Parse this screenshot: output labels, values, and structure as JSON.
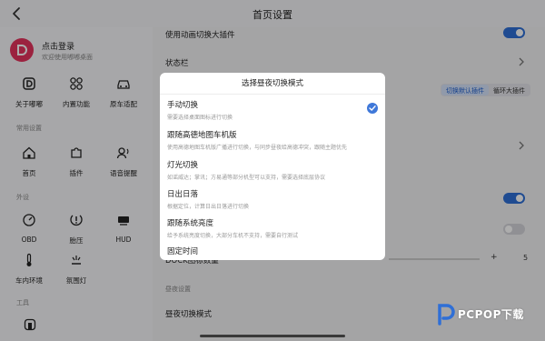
{
  "header": {
    "title": "首页设置",
    "back_icon": "chevron-left-icon"
  },
  "sidebar": {
    "user": {
      "title": "点击登录",
      "subtitle": "欢迎使用嘟嘟桌面",
      "avatar_color": "#e5335d"
    },
    "top_items": [
      {
        "label": "关于嘟嘟",
        "icon": "dudu-logo-icon"
      },
      {
        "label": "内置功能",
        "icon": "grid-icon"
      },
      {
        "label": "原车适配",
        "icon": "car-icon"
      }
    ],
    "sections": [
      {
        "label": "常用设置",
        "items": [
          {
            "label": "首页",
            "icon": "home-icon"
          },
          {
            "label": "插件",
            "icon": "puzzle-icon"
          },
          {
            "label": "语音提醒",
            "icon": "voice-icon"
          }
        ]
      },
      {
        "label": "外设",
        "items": [
          {
            "label": "OBD",
            "icon": "gauge-icon"
          },
          {
            "label": "胎压",
            "icon": "tire-pressure-icon"
          },
          {
            "label": "HUD",
            "icon": "hud-icon"
          },
          {
            "label": "车内环境",
            "icon": "thermometer-icon"
          },
          {
            "label": "氛围灯",
            "icon": "ambient-light-icon"
          }
        ]
      },
      {
        "label": "工具",
        "items": []
      }
    ]
  },
  "main": {
    "rows": {
      "animation_plugin": "使用动画切换大插件",
      "status_bar": "状态栏",
      "dock_count": "DOCK图标数量",
      "day_night_section": "昼夜设置",
      "day_night_mode": "昼夜切换模式"
    },
    "segmented": {
      "options": [
        "切换默认插件",
        "循环大插件"
      ],
      "active": "切换默认插件"
    },
    "dock_count_value": "5",
    "plus_label": "+"
  },
  "modal": {
    "title": "选择昼夜切换模式",
    "selected": "手动切换",
    "options": [
      {
        "title": "手动切换",
        "subtitle": "需要选择桌面图标进行切换"
      },
      {
        "title": "跟随高德地图车机版",
        "subtitle": "使用高德地图车机版广播进行切换，与同步昼夜给高德冲突，跟随主题优先"
      },
      {
        "title": "灯光切换",
        "subtitle": "如谣威达；掌讯；方易通等部分机型可以支持，需要选择底层协议"
      },
      {
        "title": "日出日落",
        "subtitle": "根据定位，计算日出日落进行切换"
      },
      {
        "title": "跟随系统亮度",
        "subtitle": "给予系统亮度切换，大部分车机不支持，需要自行测试"
      },
      {
        "title": "固定时间",
        "subtitle": ""
      }
    ]
  },
  "watermark": {
    "text": "PCPOP下载"
  },
  "colors": {
    "accent": "#3f78d9",
    "overlay": "rgba(0,0,0,0.32)",
    "background": "#f2f2f4"
  }
}
